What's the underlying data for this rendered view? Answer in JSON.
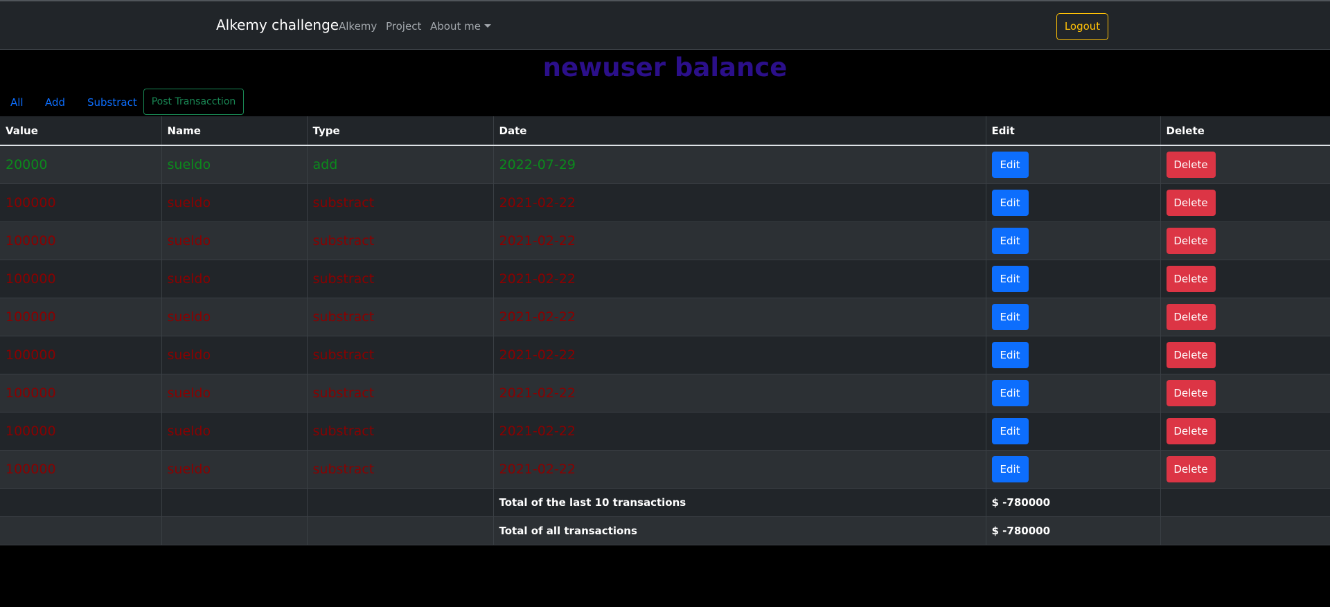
{
  "navbar": {
    "brand": "Alkemy challenge",
    "links": [
      "Alkemy",
      "Project",
      "About me"
    ],
    "logout_label": "Logout"
  },
  "page": {
    "title": "newuser balance"
  },
  "filters": {
    "all": "All",
    "add": "Add",
    "substract": "Substract",
    "post": "Post Transacction"
  },
  "table": {
    "headers": [
      "Value",
      "Name",
      "Type",
      "Date",
      "Edit",
      "Delete"
    ],
    "rows": [
      {
        "value": "20000",
        "name": "sueldo",
        "type": "add",
        "date": "2022-07-29"
      },
      {
        "value": "100000",
        "name": "sueldo",
        "type": "substract",
        "date": "2021-02-22"
      },
      {
        "value": "100000",
        "name": "sueldo",
        "type": "substract",
        "date": "2021-02-22"
      },
      {
        "value": "100000",
        "name": "sueldo",
        "type": "substract",
        "date": "2021-02-22"
      },
      {
        "value": "100000",
        "name": "sueldo",
        "type": "substract",
        "date": "2021-02-22"
      },
      {
        "value": "100000",
        "name": "sueldo",
        "type": "substract",
        "date": "2021-02-22"
      },
      {
        "value": "100000",
        "name": "sueldo",
        "type": "substract",
        "date": "2021-02-22"
      },
      {
        "value": "100000",
        "name": "sueldo",
        "type": "substract",
        "date": "2021-02-22"
      },
      {
        "value": "100000",
        "name": "sueldo",
        "type": "substract",
        "date": "2021-02-22"
      }
    ],
    "edit_label": "Edit",
    "delete_label": "Delete",
    "totals": [
      {
        "label": "Total of the last 10 transactions",
        "amount": "$ -780000"
      },
      {
        "label": "Total of all transactions",
        "amount": "$ -780000"
      }
    ]
  },
  "colors": {
    "add_text": "#0b8a1c",
    "substract_text": "#8b0000",
    "title": "#2b0f8a",
    "edit_button": "#0d6efd",
    "delete_button": "#dc3545",
    "logout_outline": "#ffc107",
    "post_outline": "#198754"
  }
}
